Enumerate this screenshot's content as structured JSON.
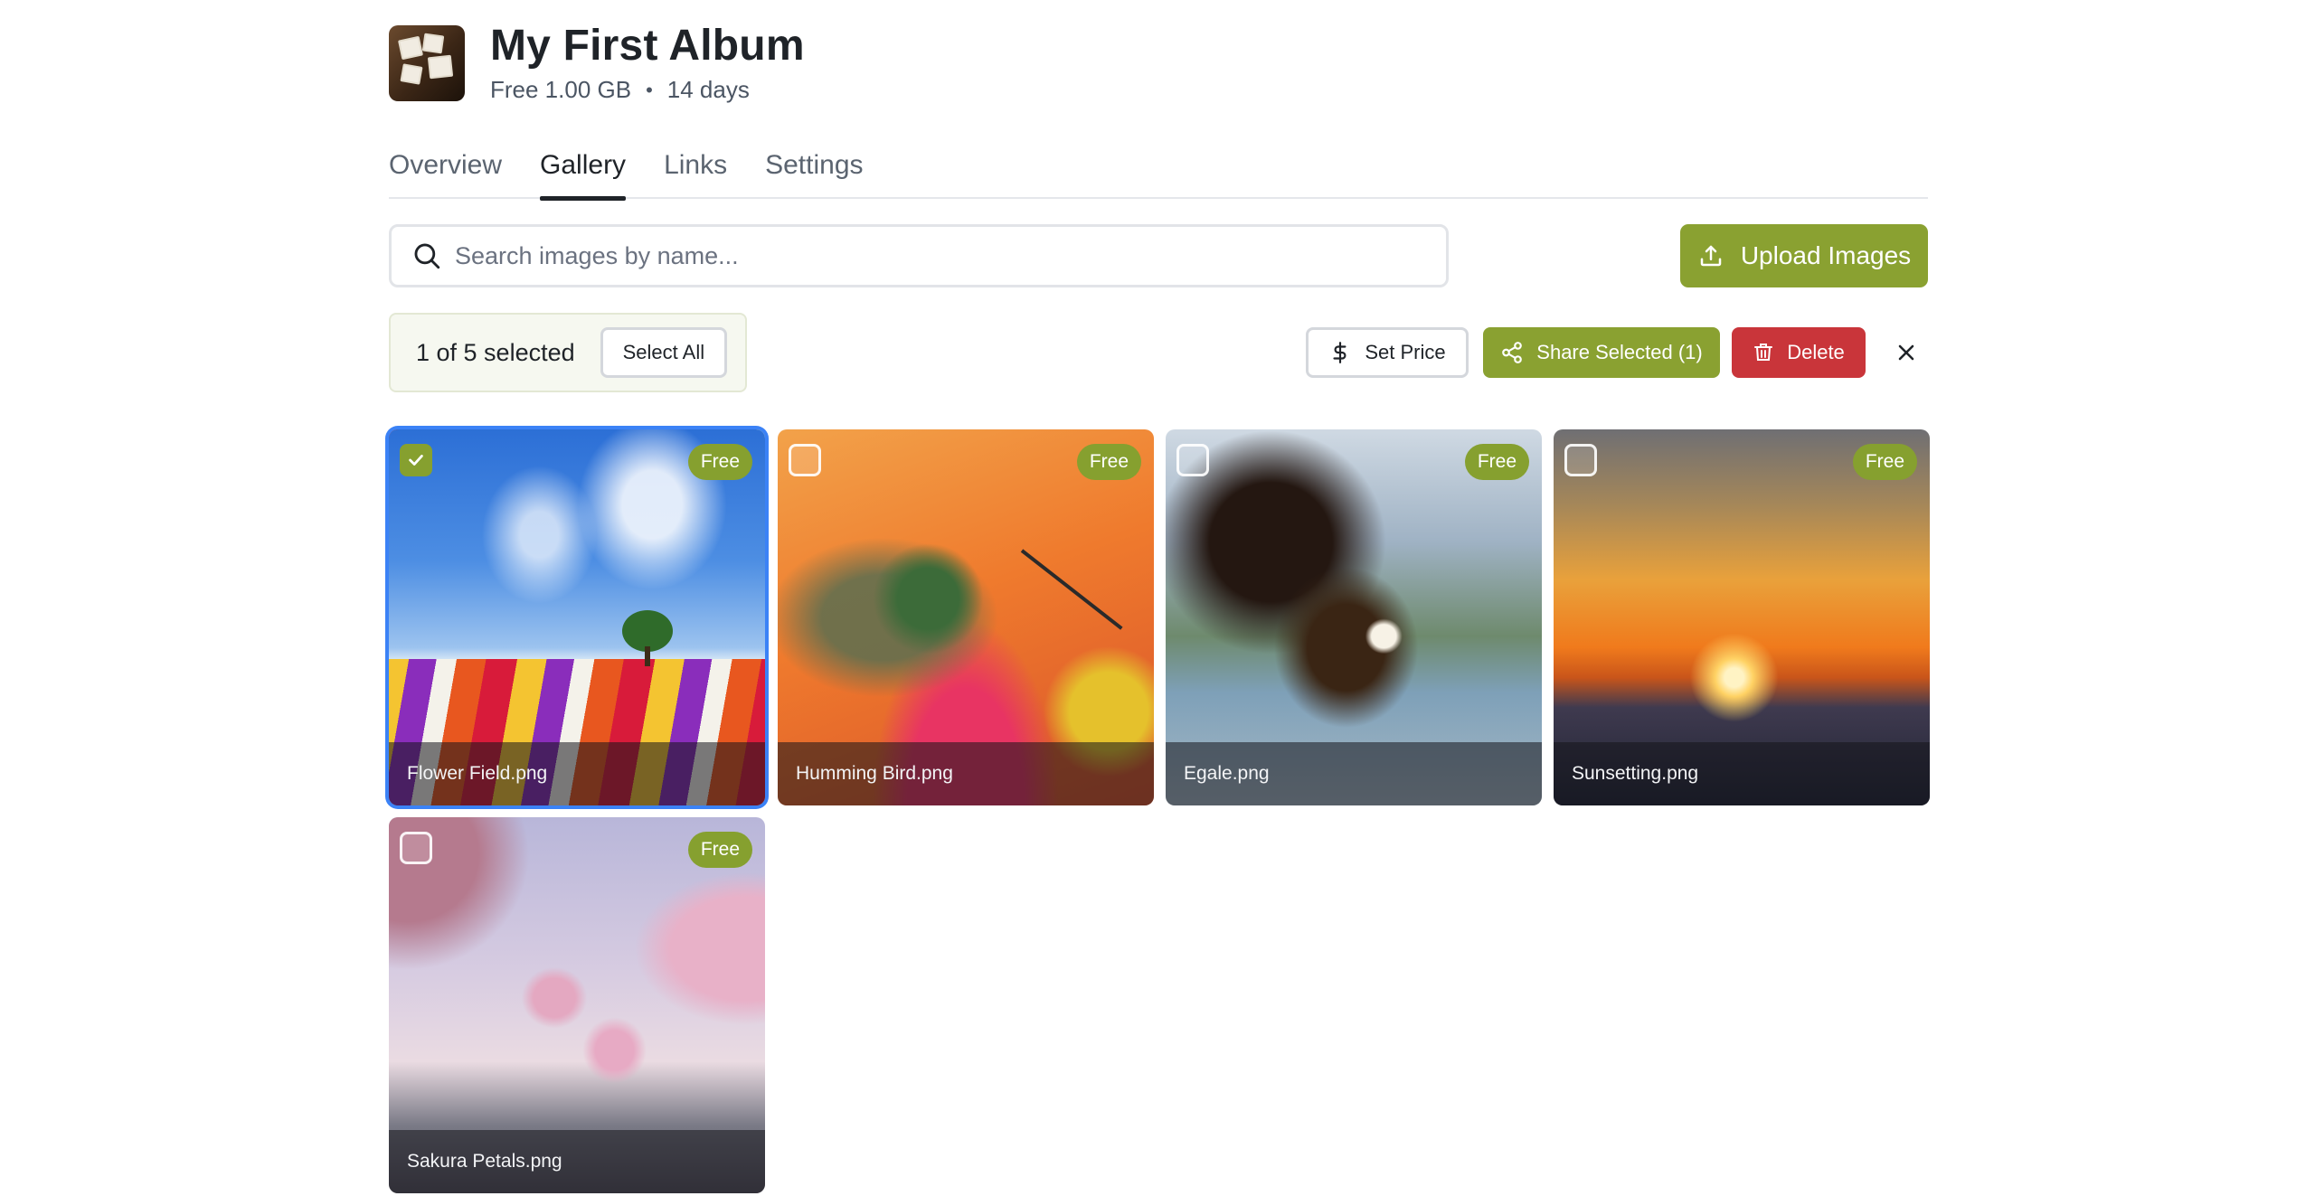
{
  "album": {
    "title": "My First Album",
    "plan": "Free 1.00 GB",
    "separator": "•",
    "duration": "14 days"
  },
  "tabs": [
    {
      "label": "Overview",
      "active": false
    },
    {
      "label": "Gallery",
      "active": true
    },
    {
      "label": "Links",
      "active": false
    },
    {
      "label": "Settings",
      "active": false
    }
  ],
  "search": {
    "placeholder": "Search images by name...",
    "value": ""
  },
  "upload": {
    "label": "Upload Images"
  },
  "selection": {
    "status": "1 of 5 selected",
    "select_all": "Select All",
    "set_price": "Set Price",
    "share_selected": "Share Selected (1)",
    "delete": "Delete"
  },
  "images": [
    {
      "name": "Flower Field.png",
      "badge": "Free",
      "selected": true
    },
    {
      "name": "Humming Bird.png",
      "badge": "Free",
      "selected": false
    },
    {
      "name": "Egale.png",
      "badge": "Free",
      "selected": false
    },
    {
      "name": "Sunsetting.png",
      "badge": "Free",
      "selected": false
    },
    {
      "name": "Sakura Petals.png",
      "badge": "Free",
      "selected": false
    }
  ],
  "colors": {
    "accent": "#8aa131",
    "danger": "#c9353a",
    "selection_outline": "#3b82f6"
  },
  "icons": [
    "search-icon",
    "upload-icon",
    "dollar-icon",
    "share-icon",
    "trash-icon",
    "close-icon",
    "check-icon"
  ]
}
